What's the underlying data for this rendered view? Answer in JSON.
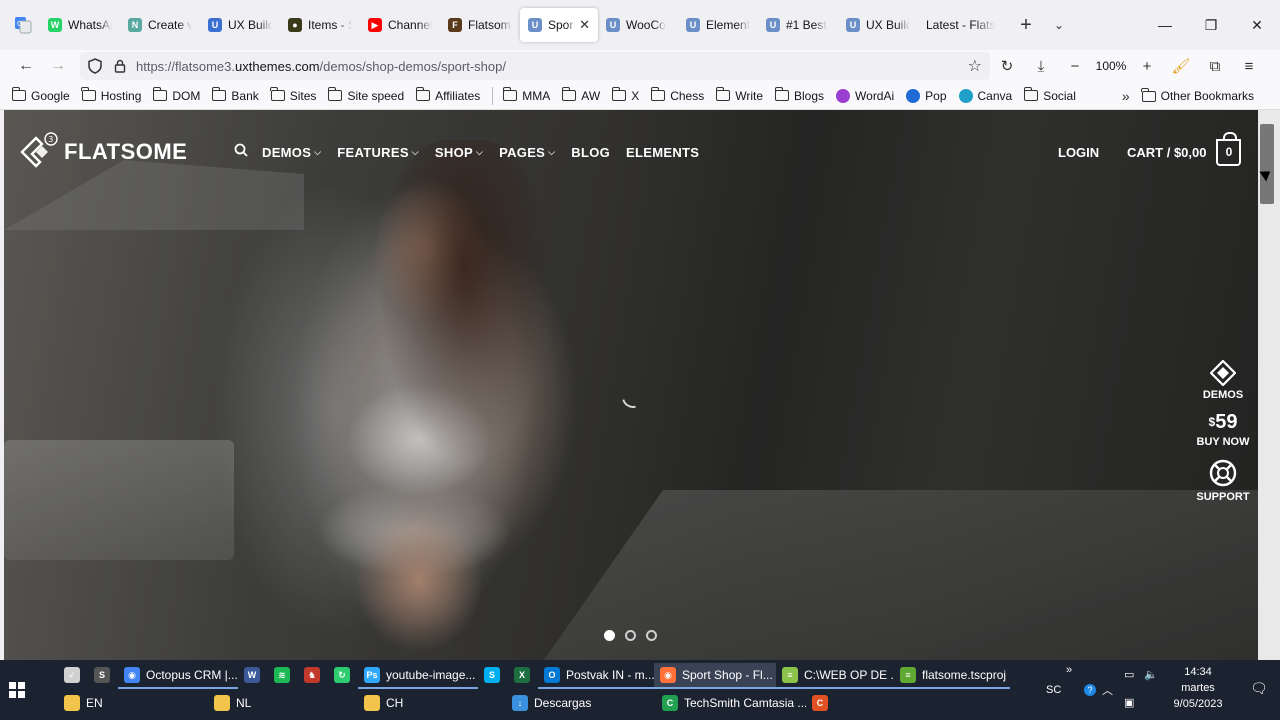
{
  "browser": {
    "tabs": [
      {
        "title": "WhatsApp",
        "fav_color": "#25d366",
        "fav_glyph": "W"
      },
      {
        "title": "Create v",
        "fav_color": "#5aa9a0",
        "fav_glyph": "N"
      },
      {
        "title": "UX Build",
        "fav_color": "#3b6fd1",
        "fav_glyph": "U"
      },
      {
        "title": "Items - S",
        "fav_color": "#3a3a1a",
        "fav_glyph": "●"
      },
      {
        "title": "Channel",
        "fav_color": "#ff0000",
        "fav_glyph": "▶"
      },
      {
        "title": "Flatsome",
        "fav_color": "#5a3a1a",
        "fav_glyph": "F"
      },
      {
        "title": "Sport",
        "fav_color": "#6b8fc7",
        "fav_glyph": "U",
        "active": true
      },
      {
        "title": "WooCo",
        "fav_color": "#6b8fc7",
        "fav_glyph": "U"
      },
      {
        "title": "Element",
        "fav_color": "#6b8fc7",
        "fav_glyph": "U"
      },
      {
        "title": "#1 Best",
        "fav_color": "#6b8fc7",
        "fav_glyph": "U"
      },
      {
        "title": "UX Build",
        "fav_color": "#6b8fc7",
        "fav_glyph": "U"
      },
      {
        "title": "Latest - Flats",
        "fav_color": "",
        "fav_glyph": ""
      }
    ],
    "url_prefix": "https://flatsome3.",
    "url_domain": "uxthemes.com",
    "url_path": "/demos/shop-demos/sport-shop/",
    "zoom": "100%",
    "bookmarks": [
      {
        "label": "Google",
        "type": "folder"
      },
      {
        "label": "Hosting",
        "type": "folder"
      },
      {
        "label": "DOM",
        "type": "folder"
      },
      {
        "label": "Bank",
        "type": "folder"
      },
      {
        "label": "Sites",
        "type": "folder"
      },
      {
        "label": "Site speed",
        "type": "folder"
      },
      {
        "label": "Affiliates",
        "type": "folder"
      },
      {
        "label": "MMA",
        "type": "folder"
      },
      {
        "label": "AW",
        "type": "folder"
      },
      {
        "label": "X",
        "type": "folder"
      },
      {
        "label": "Chess",
        "type": "folder"
      },
      {
        "label": "Write",
        "type": "folder"
      },
      {
        "label": "Blogs",
        "type": "folder"
      },
      {
        "label": "WordAi",
        "type": "dot",
        "color": "#9b3fd1"
      },
      {
        "label": "Pop",
        "type": "dot",
        "color": "#1e6ad6"
      },
      {
        "label": "Canva",
        "type": "dot",
        "color": "#20a0c8"
      },
      {
        "label": "Social",
        "type": "folder"
      }
    ],
    "other_bookmarks": "Other Bookmarks"
  },
  "site": {
    "logo_text": "FLATSOME",
    "logo_badge": "3",
    "nav": [
      {
        "label": "DEMOS",
        "has_dropdown": true
      },
      {
        "label": "FEATURES",
        "has_dropdown": true
      },
      {
        "label": "SHOP",
        "has_dropdown": true
      },
      {
        "label": "PAGES",
        "has_dropdown": true
      },
      {
        "label": "BLOG",
        "has_dropdown": false
      },
      {
        "label": "ELEMENTS",
        "has_dropdown": false
      }
    ],
    "login": "LOGIN",
    "cart_label": "CART / $0,00",
    "cart_count": "0",
    "side_widget": {
      "demos": "DEMOS",
      "price_currency": "$",
      "price_value": "59",
      "buy_now": "BUY NOW",
      "support": "SUPPORT"
    },
    "slider": {
      "total": 3,
      "active": 0
    }
  },
  "taskbar": {
    "row1": [
      {
        "label": "",
        "color": "#d0d0d0",
        "glyph": "✓"
      },
      {
        "label": "",
        "color": "#555",
        "glyph": "S"
      },
      {
        "label": "Octopus CRM |...",
        "color": "#4285f4",
        "glyph": "◉",
        "running": true
      },
      {
        "label": "",
        "color": "#3b5998",
        "glyph": "W"
      },
      {
        "label": "",
        "color": "#1db954",
        "glyph": "≋"
      },
      {
        "label": "",
        "color": "#c0392b",
        "glyph": "♞"
      },
      {
        "label": "",
        "color": "#2ecc71",
        "glyph": "↻"
      },
      {
        "label": "youtube-image...",
        "color": "#31a8ff",
        "glyph": "Ps",
        "running": true
      },
      {
        "label": "",
        "color": "#00aff0",
        "glyph": "S"
      },
      {
        "label": "",
        "color": "#1d6f42",
        "glyph": "X"
      },
      {
        "label": "Postvak IN - m...",
        "color": "#0078d4",
        "glyph": "O",
        "running": true
      },
      {
        "label": "Sport Shop - Fl...",
        "color": "#ff7139",
        "glyph": "◉",
        "running": true,
        "active": true
      },
      {
        "label": "C:\\WEB OP DE ...",
        "color": "#8bc34a",
        "glyph": "≡",
        "running": true
      },
      {
        "label": "flatsome.tscproj",
        "color": "#5fa832",
        "glyph": "≡",
        "running": true
      }
    ],
    "row2": [
      {
        "label": "EN",
        "color": "#f3c44b",
        "glyph": ""
      },
      {
        "label": "NL",
        "color": "#f3c44b",
        "glyph": ""
      },
      {
        "label": "CH",
        "color": "#f3c44b",
        "glyph": ""
      },
      {
        "label": "Descargas",
        "color": "#3a8fde",
        "glyph": "↓"
      },
      {
        "label": "TechSmith Camtasia ...",
        "color": "#20a050",
        "glyph": "C"
      },
      {
        "label": "",
        "color": "#e05020",
        "glyph": "C"
      }
    ],
    "tray_lang": "SC",
    "time": "14:34",
    "day": "martes",
    "date": "9/05/2023"
  }
}
